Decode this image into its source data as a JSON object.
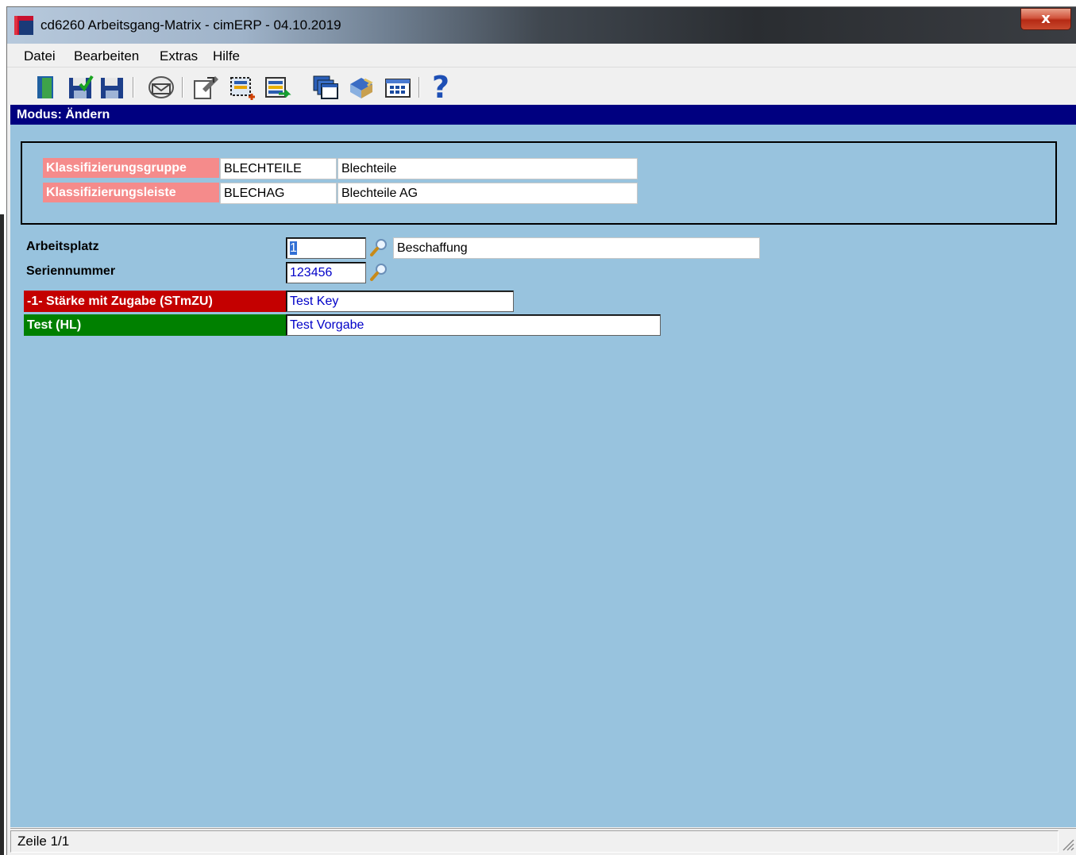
{
  "window": {
    "title": "cd6260 Arbeitsgang-Matrix - cimERP - 04.10.2019",
    "close_label": "x"
  },
  "menu": [
    "Datei",
    "Bearbeiten",
    "Extras",
    "Hilfe"
  ],
  "toolbar": {
    "buttons": [
      {
        "icon": "exit-door-icon"
      },
      {
        "icon": "save-check-icon"
      },
      {
        "icon": "save-icon"
      },
      {
        "icon": "mail-icon"
      },
      {
        "icon": "edit-properties-icon"
      },
      {
        "icon": "new-record-icon"
      },
      {
        "icon": "import-list-icon"
      },
      {
        "icon": "windows-stack-icon"
      },
      {
        "icon": "book-icon"
      },
      {
        "icon": "calculator-grid-icon"
      },
      {
        "icon": "help-icon",
        "label": "?"
      }
    ]
  },
  "mode": "Modus: Ändern",
  "classification": {
    "group_label": "Klassifizierungsgruppe",
    "group_code": "BLECHTEILE",
    "group_name": "Blechteile",
    "bar_label": "Klassifizierungsleiste",
    "bar_code": "BLECHAG",
    "bar_name": "Blechteile AG"
  },
  "arbeitsplatz": {
    "label": "Arbeitsplatz",
    "value": "1",
    "description": "Beschaffung"
  },
  "seriennummer": {
    "label": "Seriennummer",
    "value": "123456"
  },
  "parameters": [
    {
      "label": "-1- Stärke mit Zugabe (STmZU)",
      "value": "Test Key",
      "color": "#c40000"
    },
    {
      "label": "Test (HL)",
      "value": "Test Vorgabe",
      "color": "#008000"
    }
  ],
  "status": "Zeile 1/1",
  "colors": {
    "content_bg": "#98c3de",
    "mode_bar": "#000080",
    "label_pink": "#f58b8b"
  }
}
